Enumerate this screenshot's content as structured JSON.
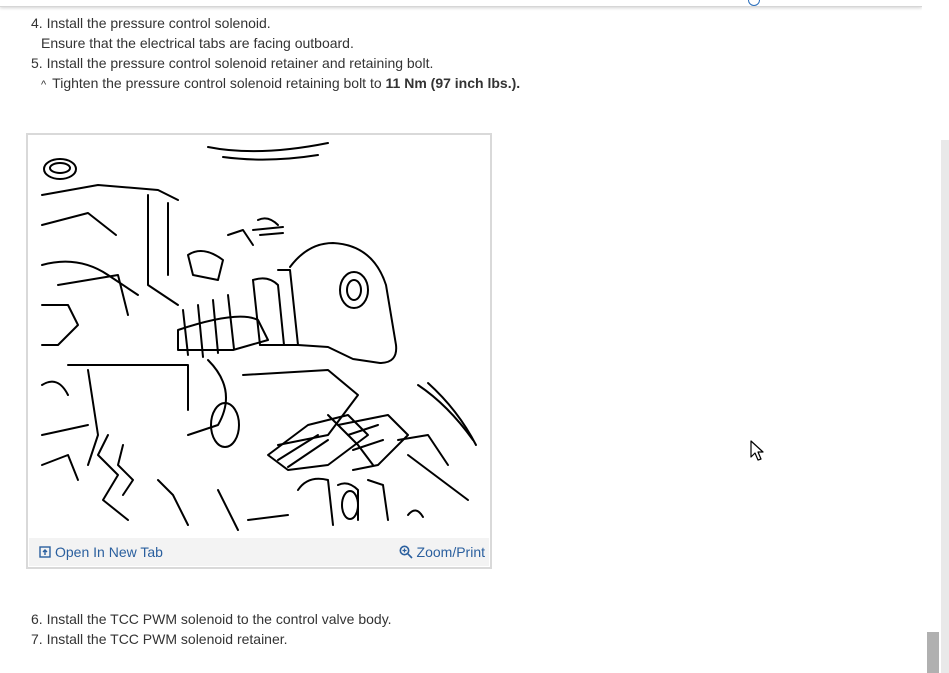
{
  "steps_top": [
    {
      "number": "4.",
      "text": "Install the pressure control solenoid."
    },
    {
      "text": "Ensure that the electrical tabs are facing outboard."
    },
    {
      "number": "5.",
      "text": "Install the pressure control solenoid retainer and retaining bolt."
    },
    {
      "caret": "^",
      "text": "Tighten the pressure control solenoid retaining bolt to ",
      "emphasis": "11 Nm (97 inch lbs.)."
    }
  ],
  "figure": {
    "open_label": "Open In New Tab",
    "zoom_label": "Zoom/Print",
    "open_icon": "open-in-new-tab-icon",
    "zoom_icon": "magnifier-icon"
  },
  "steps_bottom": [
    {
      "number": "6.",
      "text": "Install the TCC PWM solenoid to the control valve body."
    },
    {
      "number": "7.",
      "text": "Install the TCC PWM solenoid retainer."
    }
  ],
  "colors": {
    "link": "#2a5f9e",
    "text": "#333333",
    "figure_border": "#d9d9d9",
    "toolbar_bg": "#f3f3f3"
  }
}
